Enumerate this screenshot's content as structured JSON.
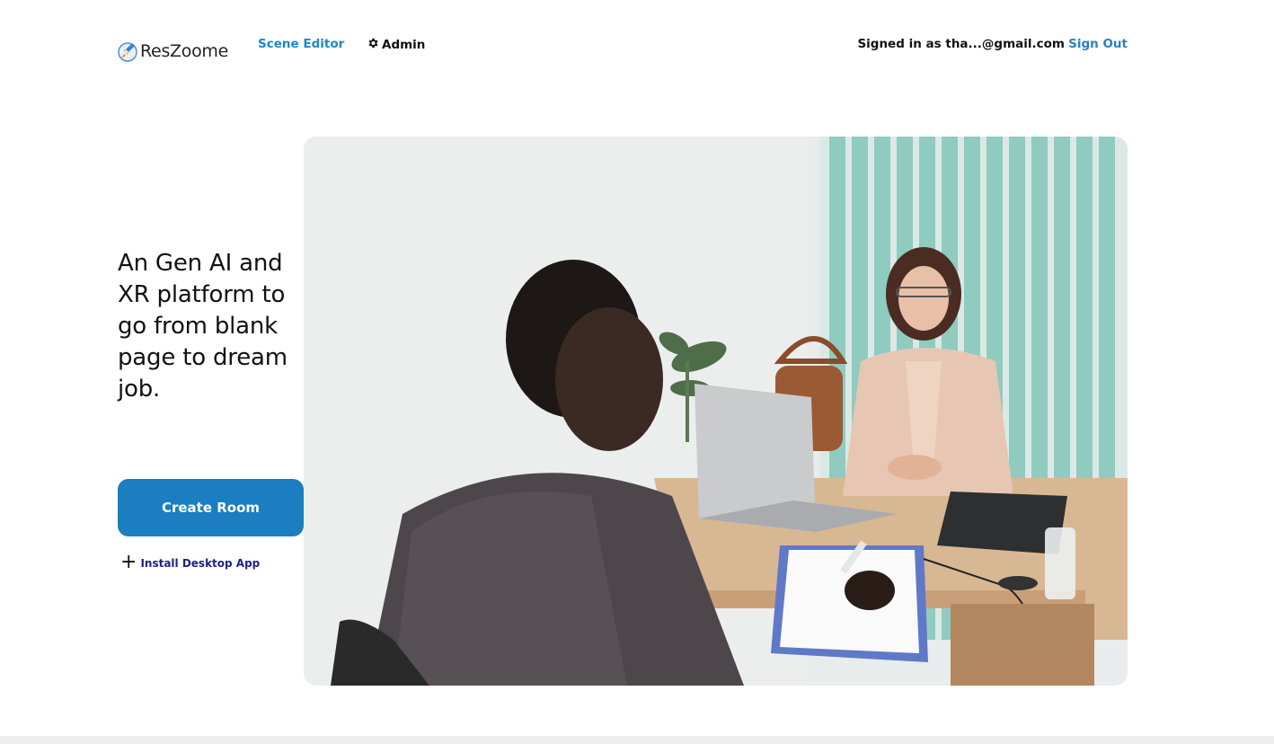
{
  "header": {
    "logo_text": "ResZoome",
    "nav": {
      "scene_editor": "Scene Editor",
      "admin": "Admin"
    },
    "signed_in_text": "Signed in as tha...@gmail.com",
    "sign_out": "Sign Out"
  },
  "hero": {
    "headline": "An Gen AI and XR platform to go from blank page to dream job.",
    "create_room": "Create Room",
    "install_app": "Install Desktop App"
  },
  "colors": {
    "primary": "#1a7ec0",
    "link_blue": "#1f86c6",
    "install_link": "#1d1e8e"
  },
  "icons": {
    "logo": "rocket-logo-icon",
    "admin": "gear-icon",
    "install": "plus-icon"
  }
}
